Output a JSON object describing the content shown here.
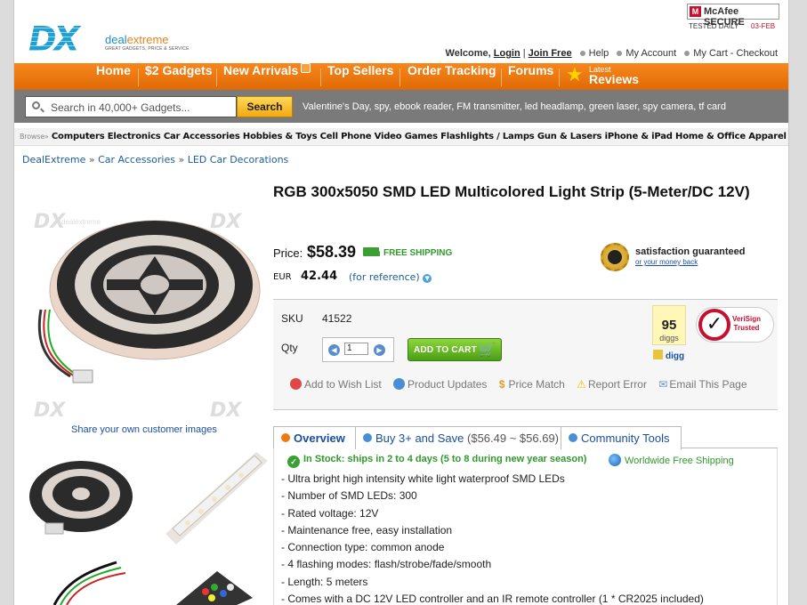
{
  "header": {
    "logo_mark": "DX",
    "logo_name_a": "deal",
    "logo_name_b": "extreme",
    "logo_tagline": "GREAT GADGETS, PRICE & SERVICE",
    "mcafee": "McAfee SECURE",
    "tested": "TESTED DAILY",
    "tested_date": "03-FEB",
    "welcome": "Welcome,",
    "login": "Login",
    "join": "Join Free",
    "help": "Help",
    "account": "My Account",
    "cart": "My Cart - Checkout"
  },
  "nav": {
    "items": [
      "Home",
      "$2 Gadgets",
      "New Arrivals",
      "Top Sellers",
      "Order Tracking",
      "Forums"
    ],
    "latest": "Latest",
    "reviews": "Reviews"
  },
  "search": {
    "placeholder": "Search in 40,000+ Gadgets...",
    "button": "Search",
    "keywords": "Valentine's Day, spy, ebook reader, FM transmitter, led headlamp, green laser, spy camera, tf card"
  },
  "browse": {
    "label": "Browse»",
    "categories": [
      "Computers",
      "Electronics",
      "Car Accessories",
      "Hobbies & Toys",
      "Cell Phone",
      "Video Games",
      "Flashlights / Lamps",
      "Gun & Lasers",
      "iPhone & iPad",
      "Home & Office",
      "Apparel"
    ]
  },
  "breadcrumb": [
    "DealExtreme",
    "Car Accessories",
    "LED Car Decorations"
  ],
  "images": {
    "share": "Share your own customer images"
  },
  "product": {
    "title": "RGB 300x5050 SMD LED Multicolored Light Strip (5-Meter/DC 12V)",
    "price_label": "Price:",
    "price": "$58.39",
    "free_shipping": "FREE SHIPPING",
    "eur_label": "EUR",
    "eur": "42.44",
    "eur_ref": "(for reference)",
    "guarantee": "satisfaction guaranteed",
    "guarantee_sub": "or your money back",
    "sku_label": "SKU",
    "sku": "41522",
    "qty_label": "Qty",
    "qty": "1",
    "add_to_cart": "ADD TO CART",
    "diggs": "95",
    "diggs_label": "diggs",
    "digg_button": "digg",
    "verisign_a": "VeriSign",
    "verisign_b": "Trusted",
    "actions": [
      "Add to Wish List",
      "Product Updates",
      "Price Match",
      "Report Error",
      "Email This Page"
    ]
  },
  "tabs": {
    "overview": "Overview",
    "buy3": "Buy 3+ and Save",
    "buy3_range": "($56.49 ~ $56.69)",
    "community": "Community Tools"
  },
  "overview": {
    "stock": "In Stock: ships in 2 to 4 days (5 to 8 during new year season)",
    "worldwide": "Worldwide Free Shipping",
    "features": [
      "- Ultra bright high intensity white light waterproof SMD LEDs",
      "- Number of SMD LEDs: 300",
      "- Rated voltage: 12V",
      "- Maintenance free, easy installation",
      "- Connection type: common anode",
      "- 4 flashing modes: flash/strobe/fade/smooth",
      "- Length: 5 meters",
      "- Comes with a DC 12V LED controller and an IR remote controller (1 * CR2025 included)"
    ]
  },
  "colors": {
    "accent_orange": "#f07a12",
    "link_blue": "#1a5d9a",
    "green": "#2f9a2a"
  }
}
